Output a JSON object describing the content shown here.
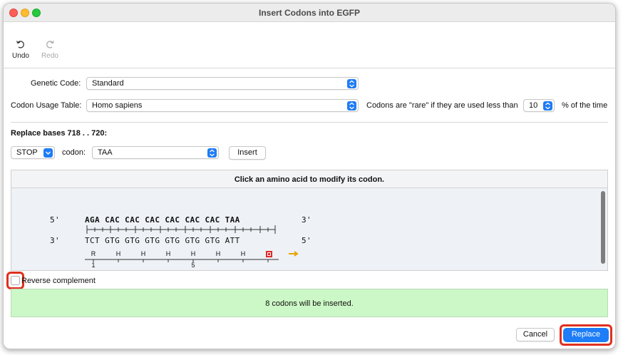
{
  "window": {
    "title": "Insert Codons into EGFP"
  },
  "toolbar": {
    "undo_label": "Undo",
    "redo_label": "Redo"
  },
  "form": {
    "genetic_code_label": "Genetic Code:",
    "genetic_code_value": "Standard",
    "codon_usage_label": "Codon Usage Table:",
    "codon_usage_value": "Homo sapiens",
    "rare_prefix": "Codons are \"rare\" if they are used less than",
    "rare_value": "10",
    "rare_suffix": "% of the time"
  },
  "replace": {
    "heading": "Replace bases 718 . . 720:",
    "amino_value": "STOP",
    "codon_label": "codon:",
    "codon_value": "TAA",
    "insert_label": "Insert"
  },
  "sequence_panel": {
    "header": "Click an amino acid to modify its codon.",
    "top_prime_left": "5'",
    "top_prime_right": "3'",
    "bottom_prime_left": "3'",
    "bottom_prime_right": "5'",
    "top_strand": "AGA CAC CAC CAC CAC CAC CAC TAA",
    "bottom_strand": "TCT GTG GTG GTG GTG GTG GTG ATT",
    "amino_acids": [
      "R",
      "H",
      "H",
      "H",
      "H",
      "H",
      "H"
    ],
    "ruler_labels": [
      "1",
      "5"
    ]
  },
  "reverse_complement_label": "Reverse complement",
  "status_message": "8 codons will be inserted.",
  "footer": {
    "cancel_label": "Cancel",
    "replace_label": "Replace"
  },
  "colors": {
    "accent": "#1e7df7",
    "success_bg": "#ccf7c6",
    "stop": "#e02828",
    "highlight": "#e0301e"
  }
}
